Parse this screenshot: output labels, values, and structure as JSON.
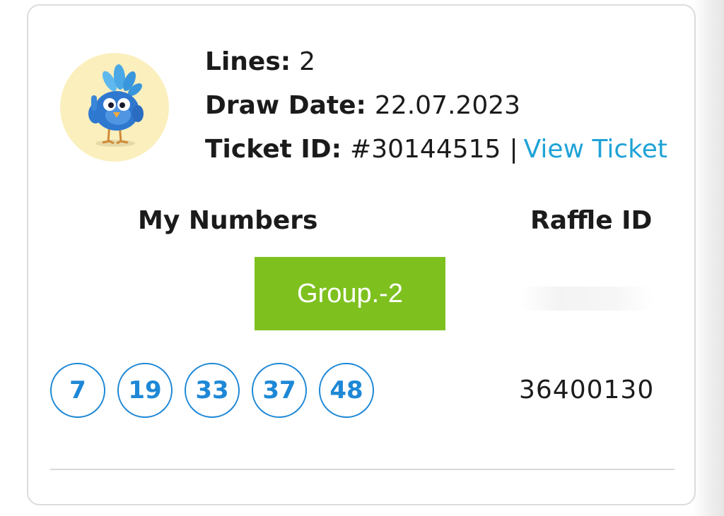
{
  "ticket": {
    "lines_label": "Lines:",
    "lines_value": "2",
    "draw_date_label": "Draw Date:",
    "draw_date_value": "22.07.2023",
    "ticket_id_label": "Ticket ID:",
    "ticket_id_value": "#30144515",
    "separator": "|",
    "view_ticket_link": "View Ticket"
  },
  "columns": {
    "my_numbers": "My Numbers",
    "raffle_id": "Raffle ID"
  },
  "group": {
    "label": "Group.-2"
  },
  "numbers": [
    "7",
    "19",
    "33",
    "37",
    "48"
  ],
  "raffle": {
    "id": "36400130"
  },
  "colors": {
    "accent_link": "#1fa3d7",
    "ball_blue": "#1e88d6",
    "group_green": "#7ec11f",
    "avatar_bg": "#fbefbd"
  },
  "icons": {
    "avatar": "bird-mascot-thumbs-up-icon"
  }
}
